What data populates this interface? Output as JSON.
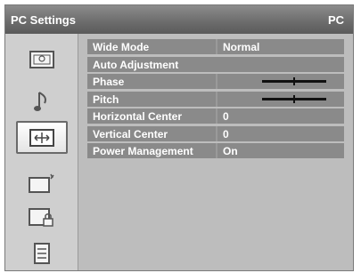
{
  "header": {
    "title": "PC Settings",
    "source": "PC"
  },
  "sidebar": {
    "items": [
      {
        "icon": "picture-icon",
        "selected": false
      },
      {
        "icon": "music-note-icon",
        "selected": false
      },
      {
        "icon": "display-position-icon",
        "selected": true
      },
      {
        "icon": "screen-setup-icon",
        "selected": false
      },
      {
        "icon": "lock-icon",
        "selected": false
      },
      {
        "icon": "list-icon",
        "selected": false
      }
    ]
  },
  "menu": {
    "rows": [
      {
        "label": "Wide Mode",
        "value": "Normal"
      },
      {
        "label": "Auto Adjustment",
        "value": ""
      },
      {
        "label": "Phase",
        "value": "",
        "slider_fraction": 0.5
      },
      {
        "label": "Pitch",
        "value": "",
        "slider_fraction": 0.5
      },
      {
        "label": "Horizontal Center",
        "value": "0"
      },
      {
        "label": "Vertical Center",
        "value": "0"
      },
      {
        "label": "Power Management",
        "value": "On"
      }
    ]
  },
  "colors": {
    "panel": "#bdbdbd",
    "row": "#8a8a8a",
    "text": "#ffffff"
  }
}
